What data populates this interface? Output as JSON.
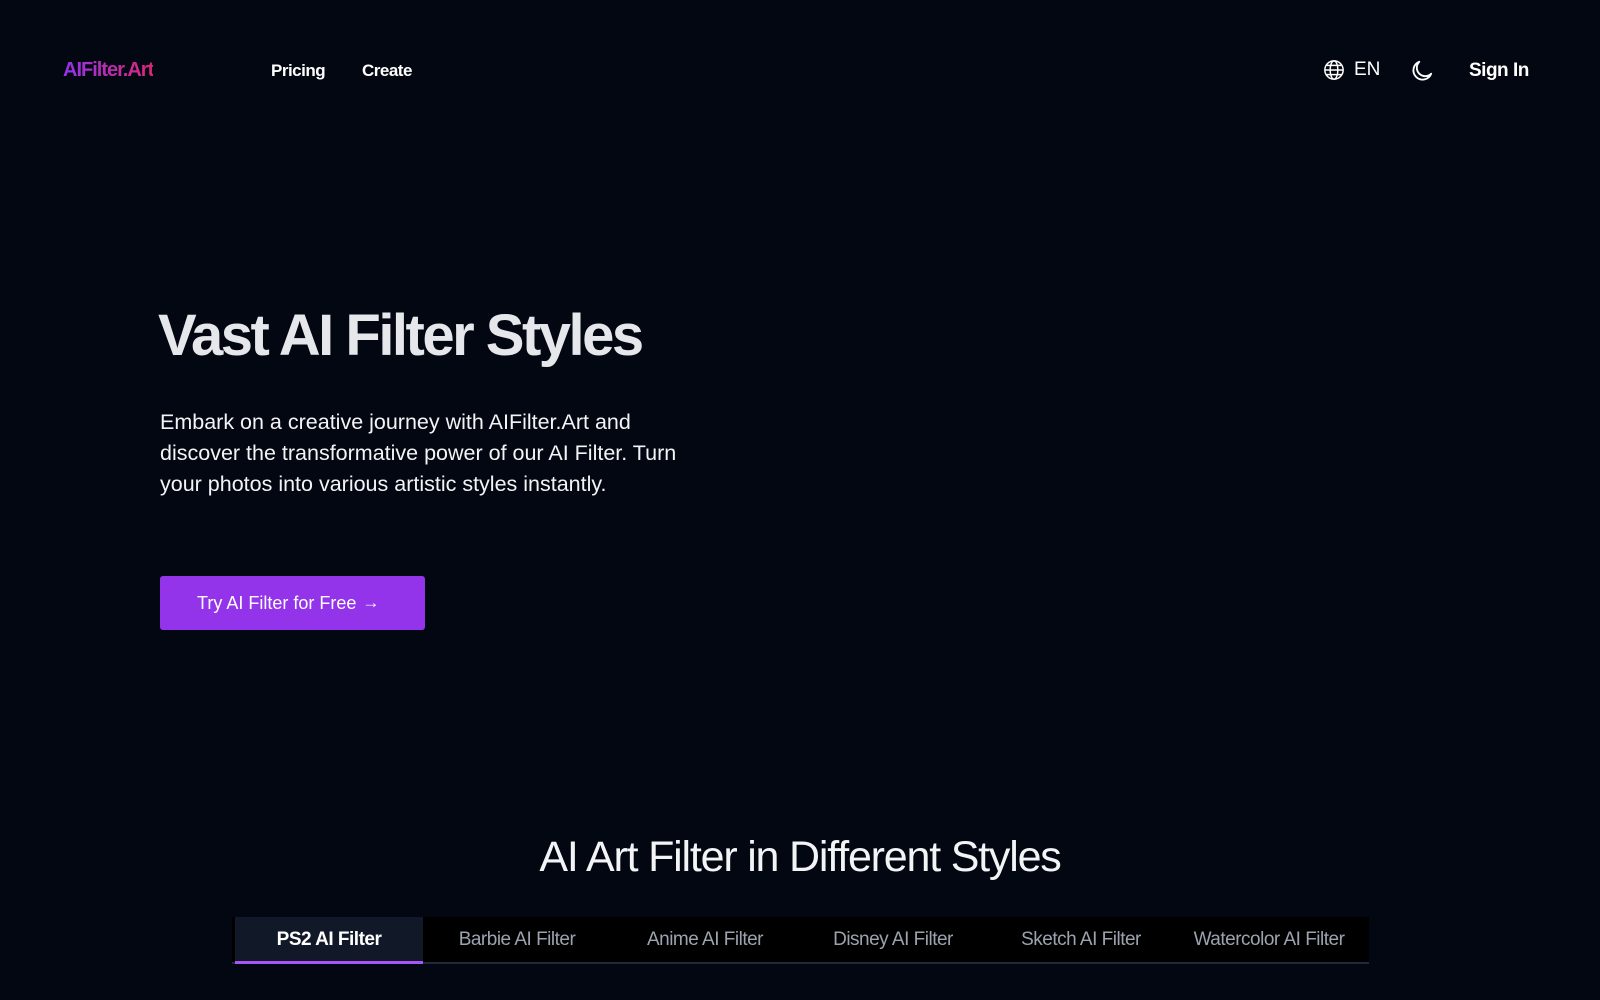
{
  "brand": {
    "logo_text": "AIFilter.Art",
    "gradient_start": "#9333ea",
    "gradient_end": "#db2777"
  },
  "nav": {
    "items": [
      {
        "label": "Pricing"
      },
      {
        "label": "Create"
      }
    ]
  },
  "header_actions": {
    "language": {
      "icon": "globe-icon",
      "label": "EN"
    },
    "theme_toggle": {
      "icon": "moon-icon"
    },
    "sign_in_label": "Sign In"
  },
  "hero": {
    "title": "Vast AI Filter Styles",
    "description": "Embark on a creative journey with AIFilter.Art and discover the transformative power of our AI Filter. Turn your photos into various artistic styles instantly.",
    "cta_label": "Try AI Filter for Free",
    "cta_icon": "arrow-right-icon",
    "cta_color": "#9333ea"
  },
  "styles_section": {
    "title": "AI Art Filter in Different Styles",
    "tabs": [
      {
        "label": "PS2 AI Filter",
        "active": true
      },
      {
        "label": "Barbie AI Filter",
        "active": false
      },
      {
        "label": "Anime AI Filter",
        "active": false
      },
      {
        "label": "Disney AI Filter",
        "active": false
      },
      {
        "label": "Sketch AI Filter",
        "active": false
      },
      {
        "label": "Watercolor AI Filter",
        "active": false
      }
    ],
    "active_tab_color": "#a855f7"
  },
  "theme": {
    "background": "#030712",
    "text": "#e5e7eb"
  }
}
